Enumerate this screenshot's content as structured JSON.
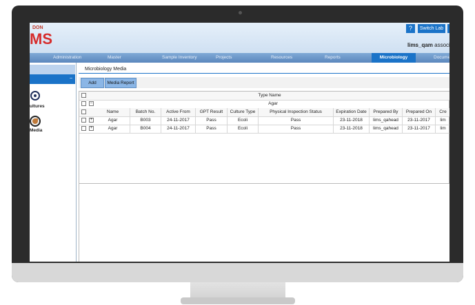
{
  "header": {
    "logo_small": "DON",
    "logo_big": "MS",
    "help_label": "?",
    "switch_lab_label": "Switch Lab",
    "user_bold": "lims_qam",
    "user_rest": " associate"
  },
  "nav": [
    {
      "label": "Administration"
    },
    {
      "label": "Master"
    },
    {
      "label": "Sample Inventory"
    },
    {
      "label": "Projects"
    },
    {
      "label": "Resources"
    },
    {
      "label": "Reports"
    },
    {
      "label": "Microbiology"
    },
    {
      "label": "Docume"
    }
  ],
  "sidebar": {
    "collapse_icon": "–",
    "items": [
      {
        "label": "ultures",
        "icon": "cultures-icon"
      },
      {
        "label": "Media",
        "icon": "media-icon"
      }
    ]
  },
  "page": {
    "title": "Microbiology Media",
    "buttons": {
      "add": "Add",
      "media_report": "Media Report"
    }
  },
  "grid": {
    "group_header": "Type Name",
    "group_value": "Agar",
    "columns": [
      "Name",
      "Batch No.",
      "Active From",
      "GPT Result",
      "Culture Type",
      "Physical Inspection Status",
      "Expiration Date",
      "Prepared By",
      "Prepared On",
      "Cre"
    ],
    "rows": [
      [
        "Agar",
        "B003",
        "24-11-2017",
        "Pass",
        "Ecoli",
        "Pass",
        "23-11-2018",
        "lims_qahead",
        "23-11-2017",
        "lim"
      ],
      [
        "Agar",
        "B004",
        "24-11-2017",
        "Pass",
        "Ecoli",
        "Pass",
        "23-11-2018",
        "lims_qahead",
        "23-11-2017",
        "lim"
      ]
    ]
  }
}
